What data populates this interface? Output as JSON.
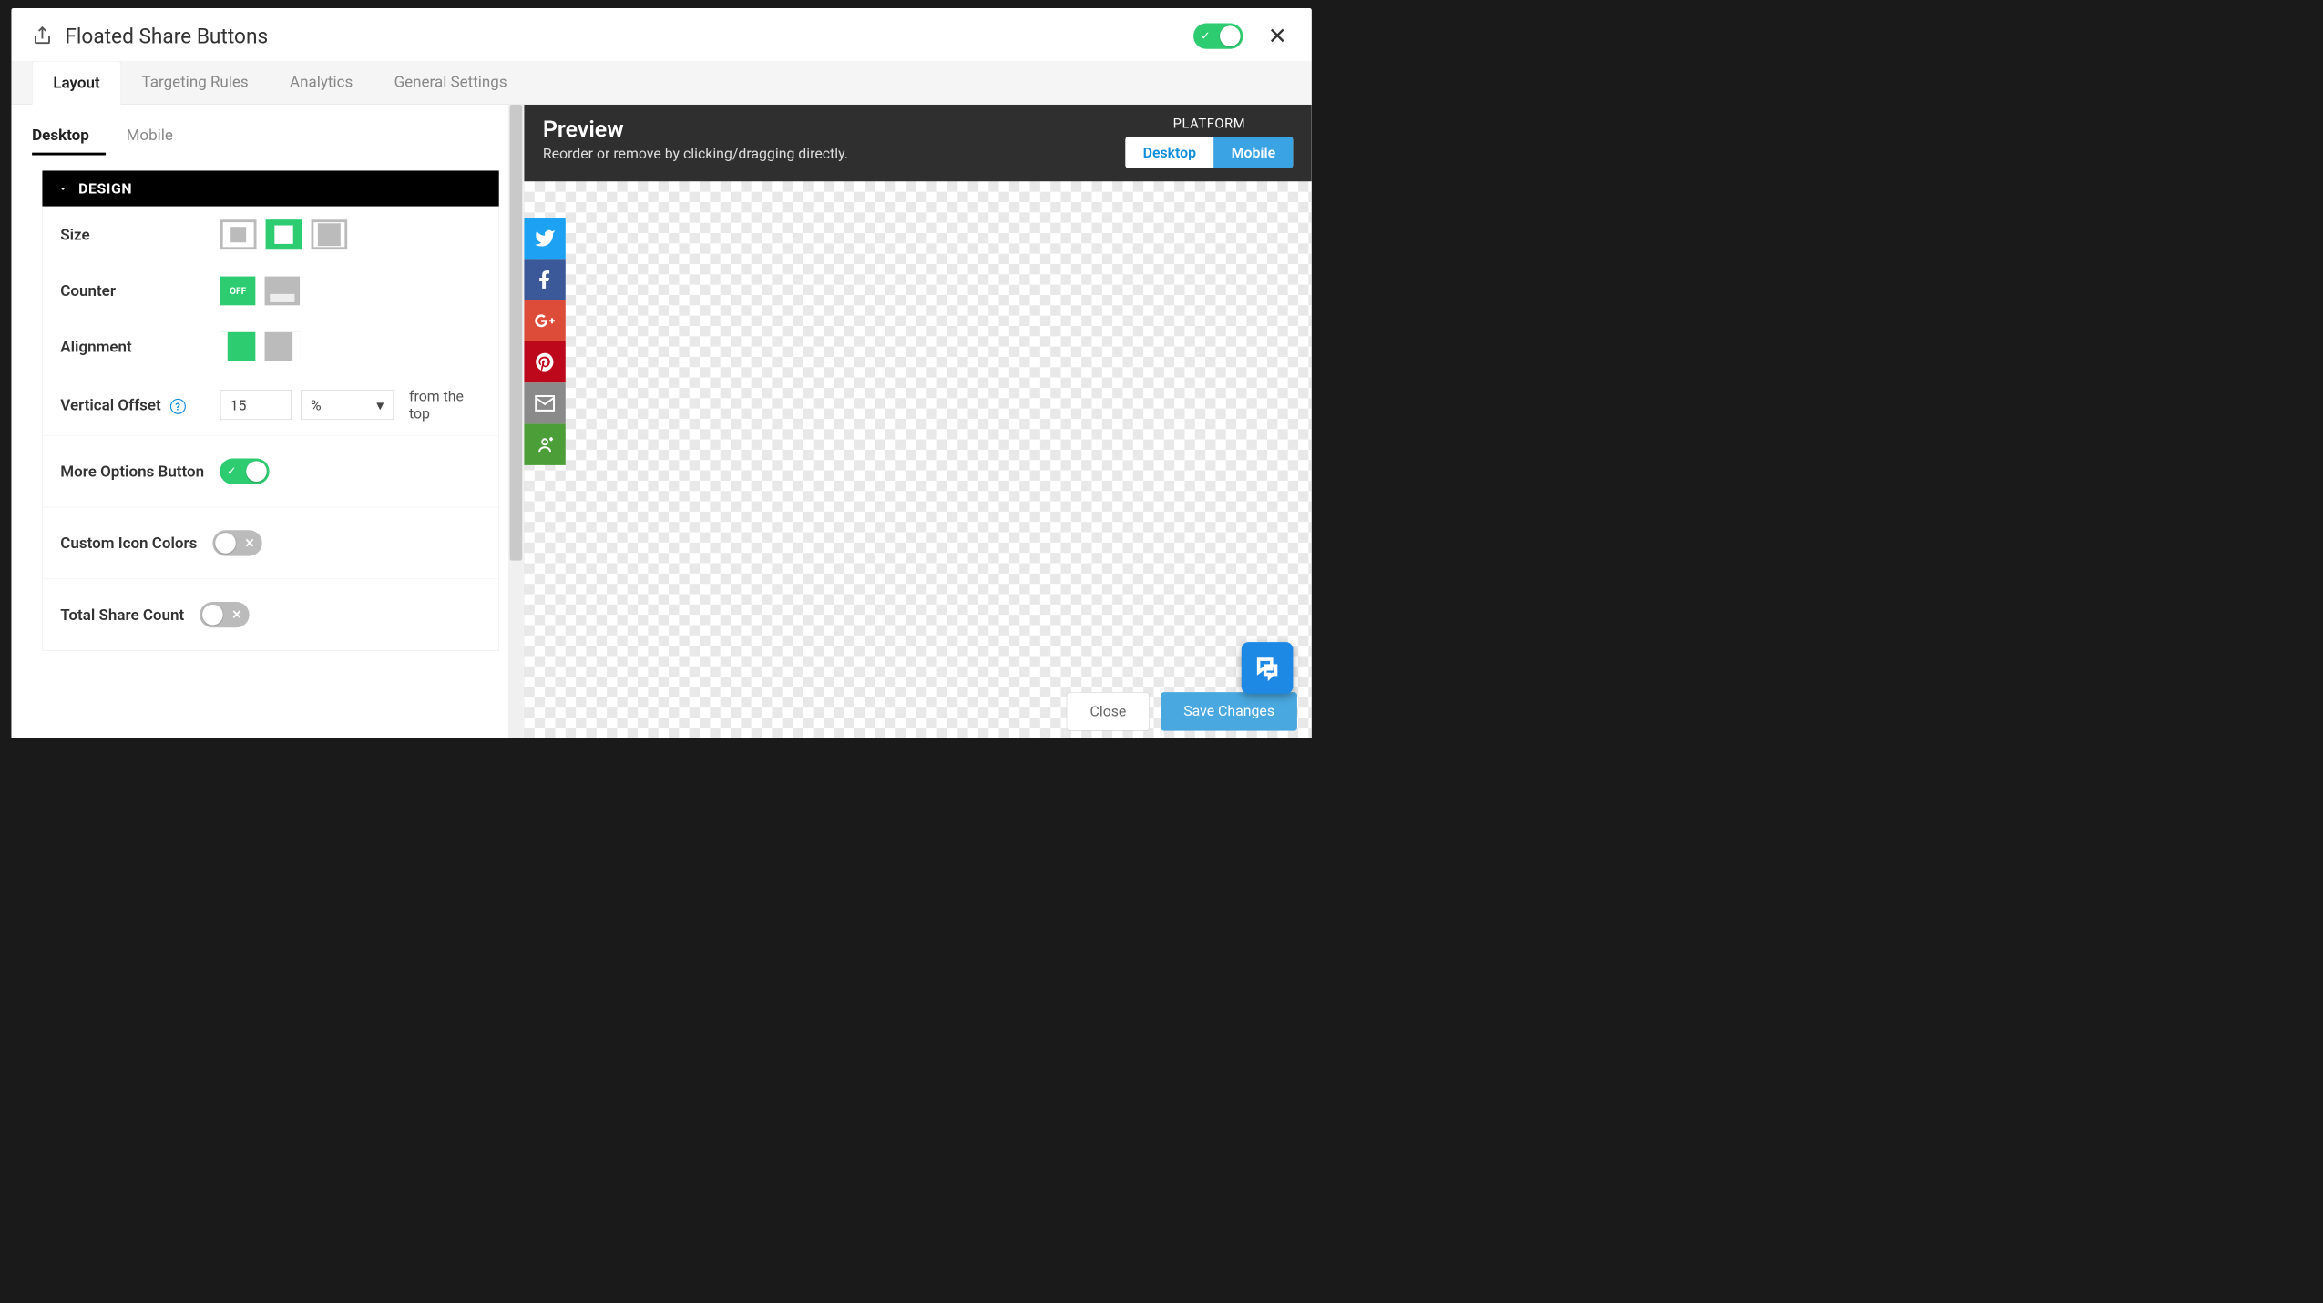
{
  "header": {
    "title": "Floated Share Buttons",
    "enabled": true
  },
  "tabs": [
    {
      "id": "layout",
      "label": "Layout",
      "active": true
    },
    {
      "id": "targeting",
      "label": "Targeting Rules",
      "active": false
    },
    {
      "id": "analytics",
      "label": "Analytics",
      "active": false
    },
    {
      "id": "general",
      "label": "General Settings",
      "active": false
    }
  ],
  "subtabs": [
    {
      "id": "desktop",
      "label": "Desktop",
      "active": true
    },
    {
      "id": "mobile",
      "label": "Mobile",
      "active": false
    }
  ],
  "design": {
    "section_label": "DESIGN",
    "rows": {
      "size": {
        "label": "Size",
        "options": [
          "s",
          "m",
          "l"
        ],
        "selected": "m"
      },
      "counter": {
        "label": "Counter",
        "off_label": "OFF",
        "selected": "off"
      },
      "alignment": {
        "label": "Alignment",
        "selected": "left"
      },
      "vertical_offset": {
        "label": "Vertical Offset",
        "value": "15",
        "unit": "%",
        "suffix": "from the top"
      },
      "more_options": {
        "label": "More Options Button",
        "value": true
      },
      "custom_colors": {
        "label": "Custom Icon Colors",
        "value": false
      },
      "total_share": {
        "label": "Total Share Count",
        "value": false
      }
    }
  },
  "preview": {
    "title": "Preview",
    "subtitle": "Reorder or remove by clicking/dragging directly.",
    "platform_label": "PLATFORM",
    "platform_desktop": "Desktop",
    "platform_mobile": "Mobile",
    "selected_platform": "mobile",
    "share_buttons": [
      "twitter",
      "facebook",
      "googleplus",
      "pinterest",
      "email",
      "more"
    ]
  },
  "footer": {
    "close": "Close",
    "save": "Save Changes"
  }
}
